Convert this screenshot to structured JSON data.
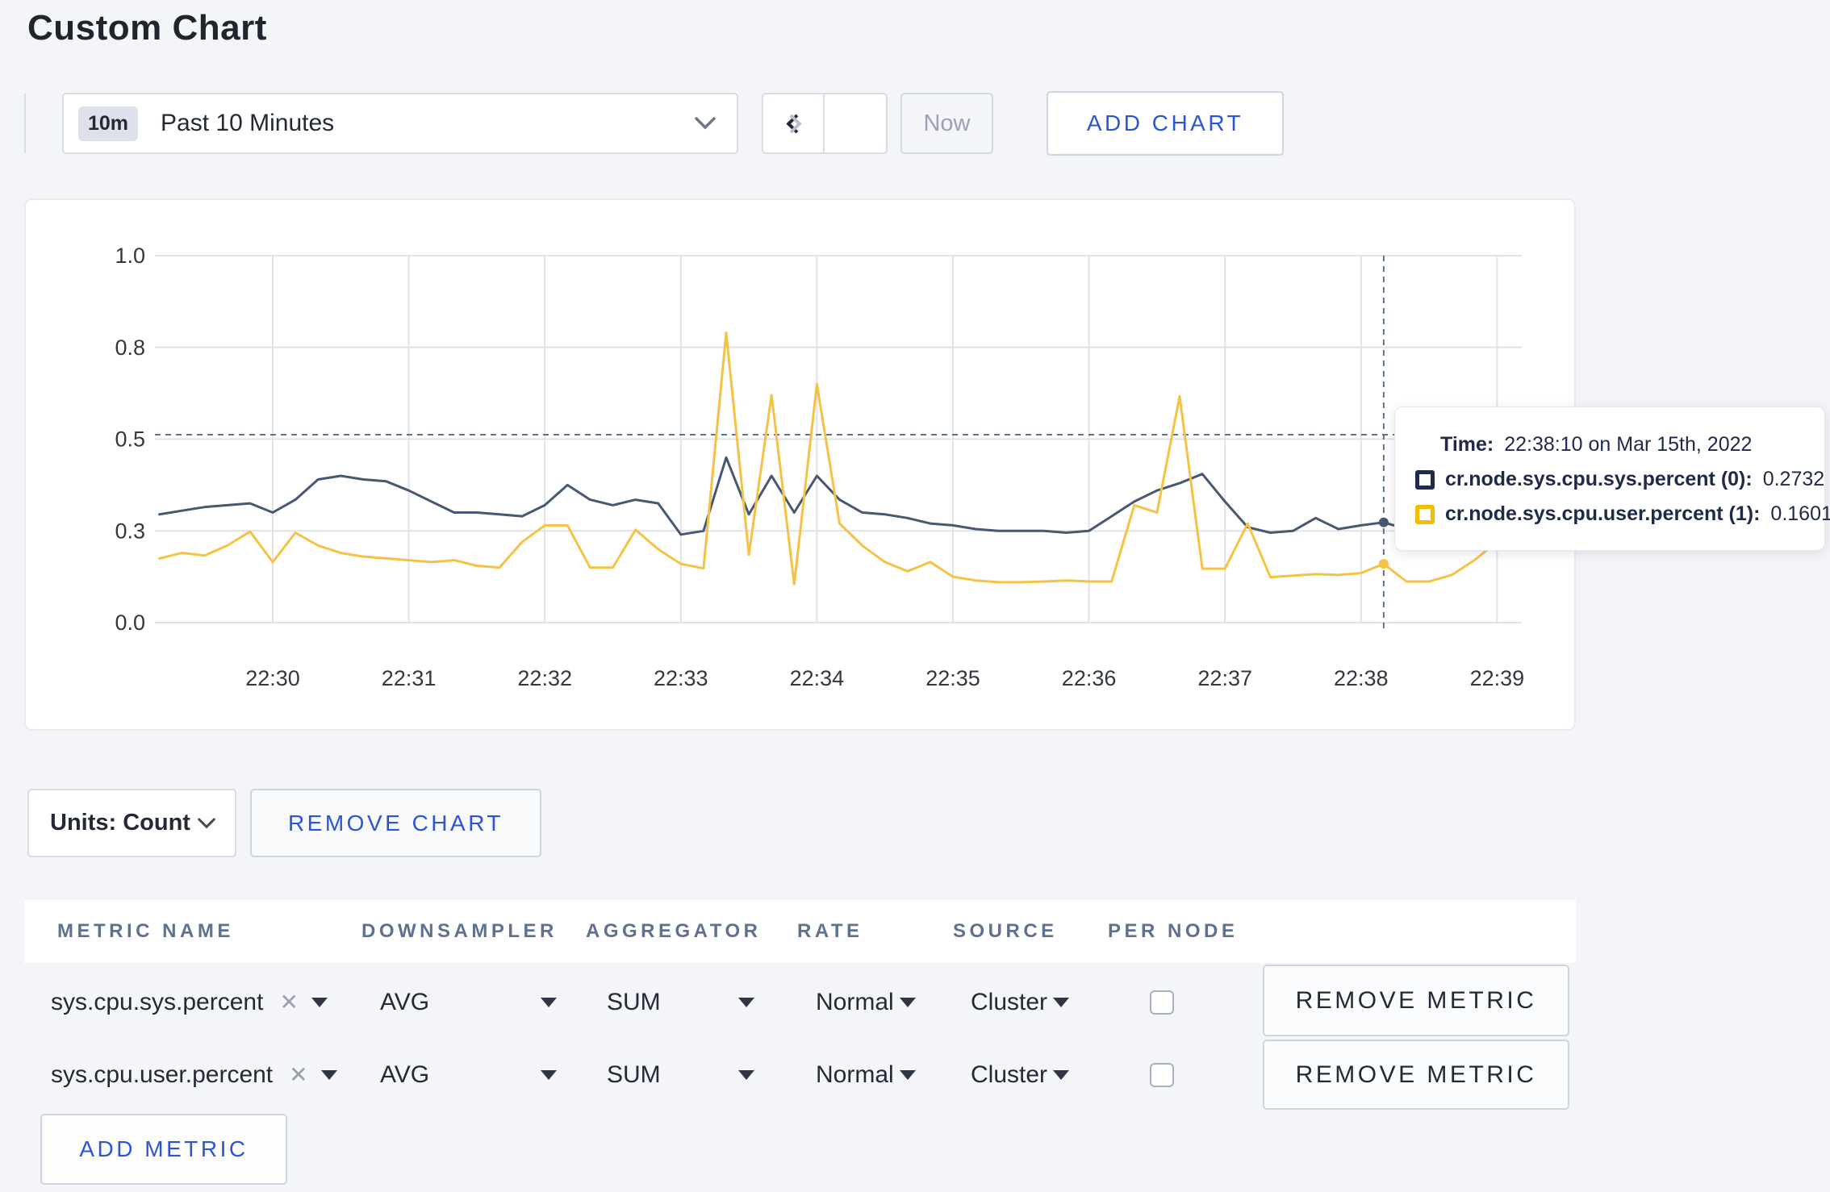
{
  "page": {
    "title": "Custom Chart"
  },
  "toolbar": {
    "range_badge": "10m",
    "range_label": "Past 10 Minutes",
    "now_label": "Now",
    "add_chart_label": "ADD CHART"
  },
  "chart_data": {
    "type": "line",
    "x_axis": {
      "tick_labels": [
        "22:30",
        "22:31",
        "22:32",
        "22:33",
        "22:34",
        "22:35",
        "22:36",
        "22:37",
        "22:38",
        "22:39"
      ],
      "start_time": "22:29:10",
      "end_time": "22:39:10"
    },
    "y_axis": {
      "tick_values": [
        0,
        0.25,
        0.5,
        0.75,
        1.0
      ],
      "tick_labels": [
        "0.0",
        "0.3",
        "0.5",
        "0.8",
        "1.0"
      ],
      "ylim": [
        0,
        1
      ]
    },
    "grid": true,
    "series": [
      {
        "name": "cr.node.sys.cpu.sys.percent",
        "color": "#475872",
        "points": [
          [
            -50,
            0.295
          ],
          [
            -40,
            0.305
          ],
          [
            -30,
            0.315
          ],
          [
            -20,
            0.32
          ],
          [
            -10,
            0.325
          ],
          [
            0,
            0.3
          ],
          [
            10,
            0.335
          ],
          [
            20,
            0.39
          ],
          [
            30,
            0.4
          ],
          [
            40,
            0.39
          ],
          [
            50,
            0.385
          ],
          [
            60,
            0.36
          ],
          [
            70,
            0.33
          ],
          [
            80,
            0.3
          ],
          [
            90,
            0.3
          ],
          [
            100,
            0.295
          ],
          [
            110,
            0.29
          ],
          [
            120,
            0.32
          ],
          [
            130,
            0.375
          ],
          [
            140,
            0.335
          ],
          [
            150,
            0.32
          ],
          [
            160,
            0.335
          ],
          [
            170,
            0.325
          ],
          [
            180,
            0.24
          ],
          [
            190,
            0.25
          ],
          [
            200,
            0.45
          ],
          [
            210,
            0.295
          ],
          [
            220,
            0.4
          ],
          [
            230,
            0.3
          ],
          [
            240,
            0.4
          ],
          [
            250,
            0.335
          ],
          [
            260,
            0.3
          ],
          [
            270,
            0.295
          ],
          [
            280,
            0.285
          ],
          [
            290,
            0.27
          ],
          [
            300,
            0.265
          ],
          [
            310,
            0.255
          ],
          [
            320,
            0.25
          ],
          [
            330,
            0.25
          ],
          [
            340,
            0.25
          ],
          [
            350,
            0.245
          ],
          [
            360,
            0.25
          ],
          [
            370,
            0.29
          ],
          [
            380,
            0.33
          ],
          [
            390,
            0.36
          ],
          [
            400,
            0.38
          ],
          [
            410,
            0.405
          ],
          [
            420,
            0.33
          ],
          [
            430,
            0.26
          ],
          [
            440,
            0.245
          ],
          [
            450,
            0.25
          ],
          [
            460,
            0.285
          ],
          [
            470,
            0.255
          ],
          [
            480,
            0.265
          ],
          [
            490,
            0.2732
          ],
          [
            500,
            0.255
          ],
          [
            510,
            0.25
          ],
          [
            520,
            0.255
          ],
          [
            530,
            0.25
          ],
          [
            540,
            0.255
          ],
          [
            550,
            0.255
          ]
        ]
      },
      {
        "name": "cr.node.sys.cpu.user.percent",
        "color": "#f5c244",
        "points": [
          [
            -50,
            0.175
          ],
          [
            -40,
            0.19
          ],
          [
            -30,
            0.183
          ],
          [
            -20,
            0.21
          ],
          [
            -10,
            0.248
          ],
          [
            0,
            0.165
          ],
          [
            10,
            0.245
          ],
          [
            20,
            0.21
          ],
          [
            30,
            0.19
          ],
          [
            40,
            0.18
          ],
          [
            50,
            0.175
          ],
          [
            60,
            0.17
          ],
          [
            70,
            0.165
          ],
          [
            80,
            0.17
          ],
          [
            90,
            0.155
          ],
          [
            100,
            0.15
          ],
          [
            110,
            0.22
          ],
          [
            120,
            0.265
          ],
          [
            130,
            0.265
          ],
          [
            140,
            0.15
          ],
          [
            150,
            0.15
          ],
          [
            160,
            0.253
          ],
          [
            170,
            0.2
          ],
          [
            180,
            0.16
          ],
          [
            190,
            0.148
          ],
          [
            200,
            0.79
          ],
          [
            210,
            0.185
          ],
          [
            220,
            0.62
          ],
          [
            230,
            0.105
          ],
          [
            240,
            0.65
          ],
          [
            250,
            0.27
          ],
          [
            260,
            0.21
          ],
          [
            270,
            0.165
          ],
          [
            280,
            0.14
          ],
          [
            290,
            0.165
          ],
          [
            300,
            0.125
          ],
          [
            310,
            0.115
          ],
          [
            320,
            0.11
          ],
          [
            330,
            0.11
          ],
          [
            340,
            0.112
          ],
          [
            350,
            0.115
          ],
          [
            360,
            0.112
          ],
          [
            370,
            0.112
          ],
          [
            380,
            0.32
          ],
          [
            390,
            0.3
          ],
          [
            400,
            0.617
          ],
          [
            410,
            0.147
          ],
          [
            420,
            0.147
          ],
          [
            430,
            0.27
          ],
          [
            440,
            0.124
          ],
          [
            450,
            0.128
          ],
          [
            460,
            0.132
          ],
          [
            470,
            0.13
          ],
          [
            480,
            0.135
          ],
          [
            490,
            0.1601
          ],
          [
            500,
            0.112
          ],
          [
            510,
            0.112
          ],
          [
            520,
            0.13
          ],
          [
            530,
            0.17
          ],
          [
            540,
            0.22
          ],
          [
            550,
            0.27
          ]
        ]
      }
    ],
    "crosshair": {
      "time": "22:38:10",
      "t": 490,
      "mouse_value": 0.512
    },
    "tooltip": {
      "time_label": "Time:",
      "time_value": "22:38:10 on Mar 15th, 2022",
      "rows": [
        {
          "label": "cr.node.sys.cpu.sys.percent (0):",
          "value": "0.2732",
          "color": "#1e2b4e"
        },
        {
          "label": "cr.node.sys.cpu.user.percent (1):",
          "value": "0.1601",
          "color": "#f5bc00"
        }
      ]
    }
  },
  "chart_controls": {
    "units_label": "Units: Count",
    "remove_chart_label": "REMOVE CHART"
  },
  "metrics_table": {
    "headers": [
      "METRIC NAME",
      "DOWNSAMPLER",
      "AGGREGATOR",
      "RATE",
      "SOURCE",
      "PER NODE"
    ],
    "rows": [
      {
        "metric": "sys.cpu.sys.percent",
        "downsampler": "AVG",
        "aggregator": "SUM",
        "rate": "Normal",
        "source": "Cluster",
        "per_node_checked": false,
        "remove_label": "REMOVE METRIC"
      },
      {
        "metric": "sys.cpu.user.percent",
        "downsampler": "AVG",
        "aggregator": "SUM",
        "rate": "Normal",
        "source": "Cluster",
        "per_node_checked": false,
        "remove_label": "REMOVE METRIC"
      }
    ],
    "add_metric_label": "ADD METRIC"
  }
}
